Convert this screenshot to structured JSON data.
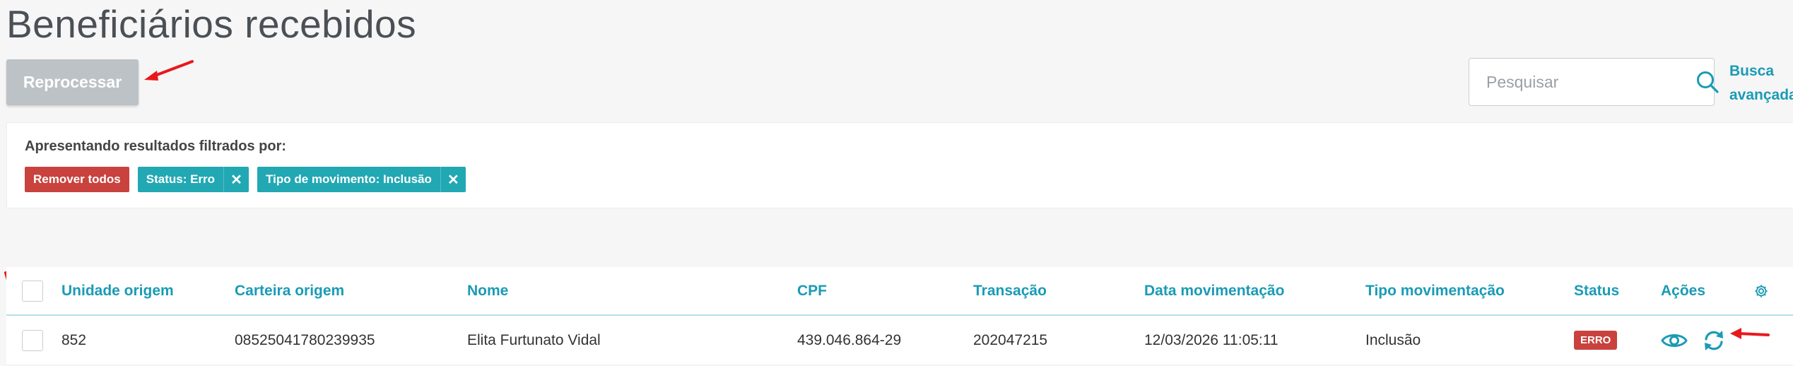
{
  "page": {
    "title": "Beneficiários recebidos"
  },
  "toolbar": {
    "reprocess_label": "Reprocessar"
  },
  "search": {
    "placeholder": "Pesquisar",
    "advanced_label": "Busca avançada"
  },
  "filters": {
    "label": "Apresentando resultados filtrados por:",
    "remove_all_label": "Remover todos",
    "chips": [
      {
        "label": "Status: Erro",
        "remove": "✕"
      },
      {
        "label": "Tipo de movimento: Inclusão",
        "remove": "✕"
      }
    ]
  },
  "table": {
    "columns": {
      "unidade": "Unidade origem",
      "carteira": "Carteira origem",
      "nome": "Nome",
      "cpf": "CPF",
      "transacao": "Transação",
      "data": "Data movimentação",
      "tipo": "Tipo movimentação",
      "status": "Status",
      "acoes": "Ações"
    },
    "rows": [
      {
        "unidade": "852",
        "carteira": "08525041780239935",
        "nome": "Elita Furtunato Vidal",
        "cpf": "439.046.864-29",
        "transacao": "202047215",
        "data": "12/03/2026 11:05:11",
        "tipo": "Inclusão",
        "status": "ERRO"
      }
    ]
  },
  "colors": {
    "accent": "#1a9bb5",
    "danger": "#c9423e",
    "chip": "#21a8b3",
    "disabled_button": "#bcc2c6",
    "annotation_arrow": "#e8191c"
  },
  "icons": [
    "search-icon",
    "gear-icon",
    "eye-icon",
    "refresh-icon",
    "close-icon"
  ]
}
